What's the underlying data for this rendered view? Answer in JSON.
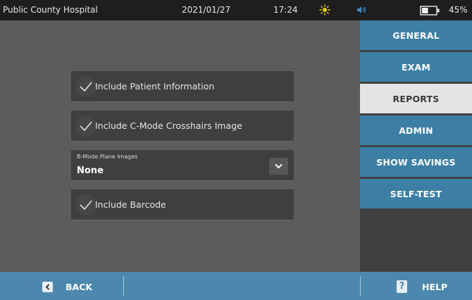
{
  "status": {
    "hospital": "Public County Hospital",
    "date": "2021/01/27",
    "time": "17:24",
    "battery_percent": "45%",
    "battery_level": 0.45,
    "icons": [
      "brightness-icon",
      "speaker-icon",
      "battery-icon"
    ]
  },
  "sidebar": {
    "items": [
      {
        "label": "GENERAL",
        "active": false
      },
      {
        "label": "EXAM",
        "active": false
      },
      {
        "label": "REPORTS",
        "active": true
      },
      {
        "label": "ADMIN",
        "active": false
      },
      {
        "label": "SHOW SAVINGS",
        "active": false
      },
      {
        "label": "SELF-TEST",
        "active": false
      }
    ]
  },
  "options": {
    "patient_info": {
      "label": "Include Patient Information",
      "checked": true
    },
    "crosshairs": {
      "label": "Include C-Mode Crosshairs Image",
      "checked": true
    },
    "bmode": {
      "label": "B-Mode Plane Images",
      "value": "None"
    },
    "barcode": {
      "label": "Include Barcode",
      "checked": true
    }
  },
  "bottom": {
    "back_label": "BACK",
    "help_label": "HELP",
    "help_symbol": "?"
  },
  "colors": {
    "nav_blue": "#3d7fa4",
    "nav_active": "#e4e4e4",
    "bottom_bar": "#4c88ad",
    "status_bar": "#1e1e1e",
    "brightness_icon": "#f0d000",
    "speaker_icon": "#3d8fd0"
  }
}
